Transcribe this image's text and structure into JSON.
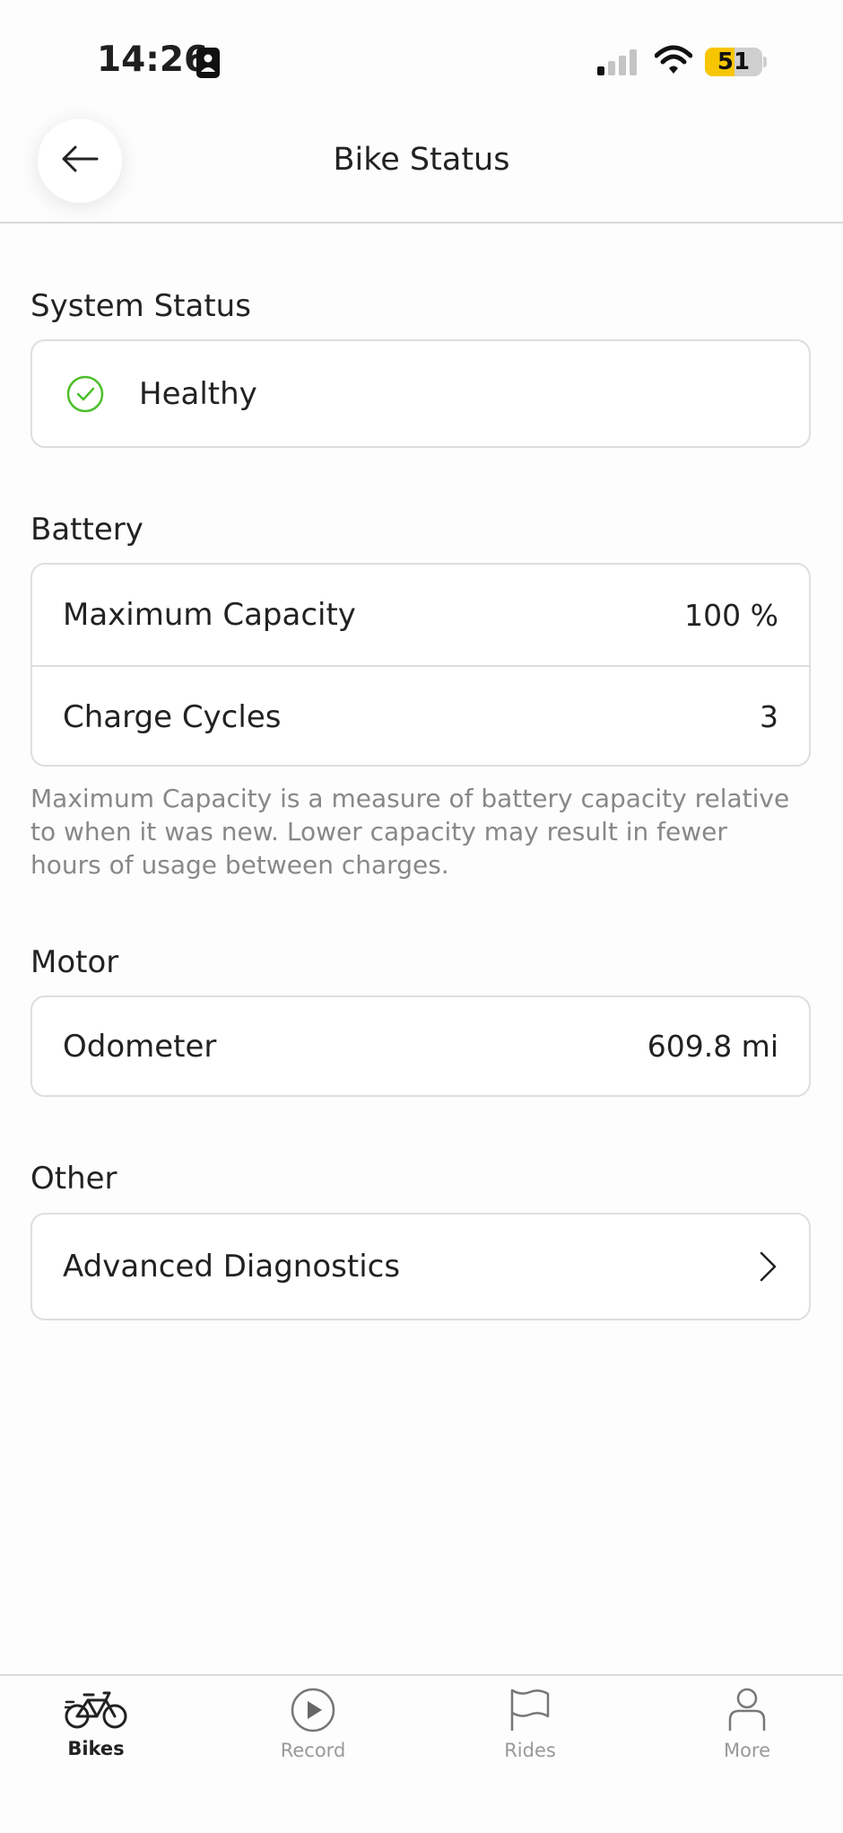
{
  "status_bar": {
    "time": "14:26",
    "battery_level": "51"
  },
  "header": {
    "title": "Bike Status"
  },
  "system_status": {
    "title": "System Status",
    "status": "Healthy",
    "status_color": "#4cbf2a"
  },
  "battery": {
    "title": "Battery",
    "rows": [
      {
        "label": "Maximum Capacity",
        "value": "100 %"
      },
      {
        "label": "Charge Cycles",
        "value": "3"
      }
    ],
    "note": "Maximum Capacity is a measure of battery capacity relative to when it was new. Lower capacity may result in fewer hours of usage between charges."
  },
  "motor": {
    "title": "Motor",
    "rows": [
      {
        "label": "Odometer",
        "value": "609.8 mi"
      }
    ]
  },
  "other": {
    "title": "Other",
    "rows": [
      {
        "label": "Advanced Diagnostics"
      }
    ]
  },
  "tabs": [
    {
      "label": "Bikes",
      "icon": "bike-icon",
      "active": true
    },
    {
      "label": "Record",
      "icon": "play-circle-icon",
      "active": false
    },
    {
      "label": "Rides",
      "icon": "flag-icon",
      "active": false
    },
    {
      "label": "More",
      "icon": "person-icon",
      "active": false
    }
  ]
}
